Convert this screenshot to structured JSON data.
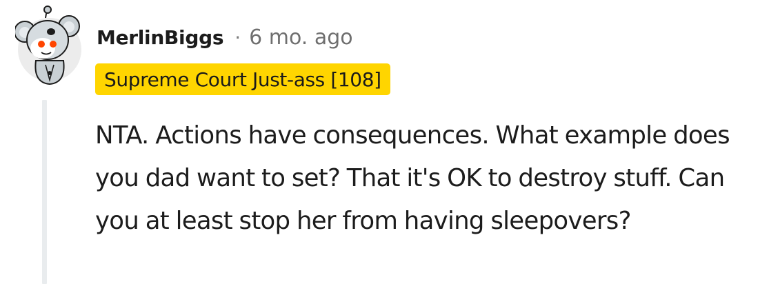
{
  "comment": {
    "author": "MerlinBiggs",
    "separator": "·",
    "timestamp": "6 mo. ago",
    "flair": "Supreme Court Just-ass [108]",
    "body": "NTA. Actions have consequences. What example does you dad want to set? That it's OK to destroy stuff. Can you at least stop her from having sleepovers?",
    "avatar_icon": "koala-snoo-avatar-icon"
  },
  "colors": {
    "flair_background": "#ffd500",
    "thread_line": "#e9ecee",
    "timestamp": "#6f6f6f"
  }
}
